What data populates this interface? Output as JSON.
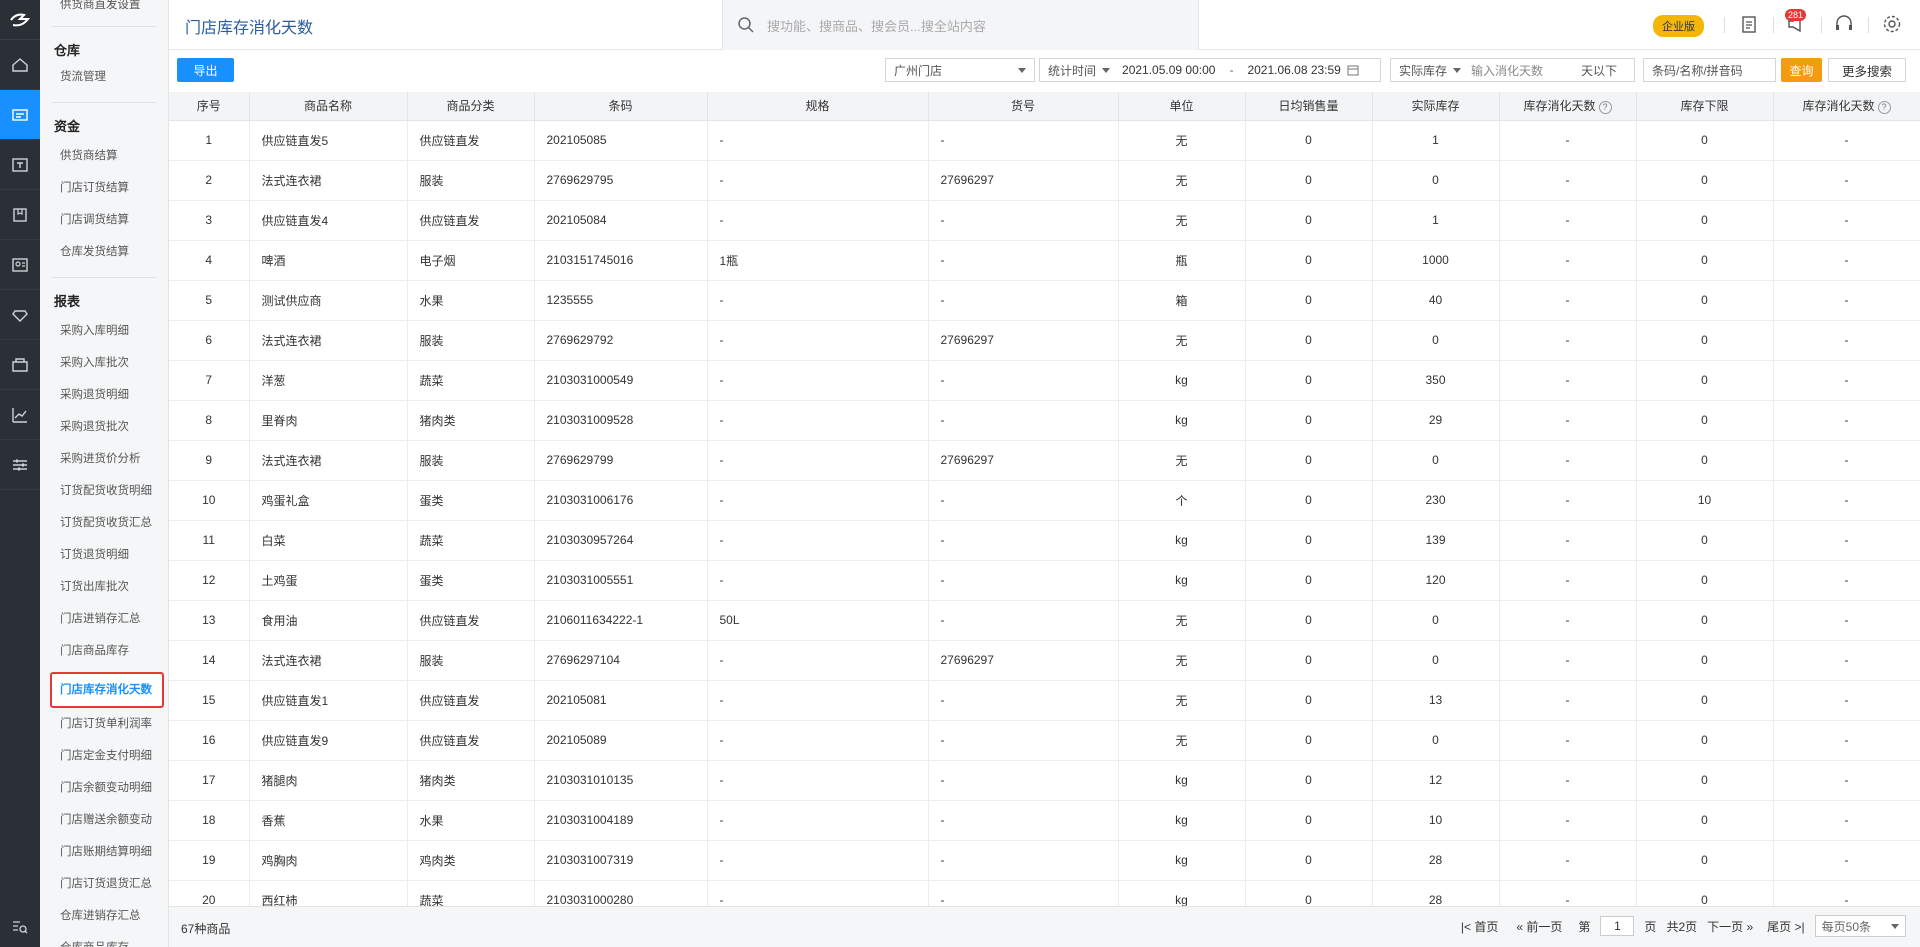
{
  "header": {
    "title": "门店库存消化天数",
    "search_placeholder": "搜功能、搜商品、搜会员...搜全站内容",
    "edition": "企业版",
    "notify_count": "281"
  },
  "menu": {
    "top_item": "供货商直发设置",
    "sections": [
      {
        "title": "仓库",
        "items": [
          "货流管理"
        ]
      },
      {
        "title": "资金",
        "items": [
          "供货商结算",
          "门店订货结算",
          "门店调货结算",
          "仓库发货结算"
        ]
      },
      {
        "title": "报表",
        "items": [
          "采购入库明细",
          "采购入库批次",
          "采购退货明细",
          "采购退货批次",
          "采购进货价分析",
          "订货配货收货明细",
          "订货配货收货汇总",
          "订货退货明细",
          "订货出库批次",
          "门店进销存汇总",
          "门店商品库存",
          "门店库存消化天数",
          "门店订货单利润率",
          "门店定金支付明细",
          "门店余额变动明细",
          "门店赠送余额变动",
          "门店账期结算明细",
          "门店订货退货汇总",
          "仓库进销存汇总",
          "仓库商品库存"
        ]
      }
    ],
    "active": "门店库存消化天数"
  },
  "toolbar": {
    "export": "导出",
    "store": "广州门店",
    "stat_time": "统计时间",
    "date_from": "2021.05.09 00:00",
    "date_sep": "-",
    "date_to": "2021.06.08 23:59",
    "stock_type": "实际库存",
    "days_placeholder": "输入消化天数",
    "days_suffix": "天以下",
    "code_placeholder": "条码/名称/拼音码",
    "query": "查询",
    "more": "更多搜索"
  },
  "table": {
    "headers": [
      "序号",
      "商品名称",
      "商品分类",
      "条码",
      "规格",
      "货号",
      "单位",
      "日均销售量",
      "实际库存",
      "库存消化天数",
      "库存下限",
      "库存消化天数"
    ],
    "rows": [
      [
        "1",
        "供应链直发5",
        "供应链直发",
        "202105085",
        "-",
        "-",
        "无",
        "0",
        "1",
        "-",
        "0",
        "-"
      ],
      [
        "2",
        "法式连衣裙",
        "服装",
        "2769629795",
        "-",
        "27696297",
        "无",
        "0",
        "0",
        "-",
        "0",
        "-"
      ],
      [
        "3",
        "供应链直发4",
        "供应链直发",
        "202105084",
        "-",
        "-",
        "无",
        "0",
        "1",
        "-",
        "0",
        "-"
      ],
      [
        "4",
        "啤酒",
        "电子烟",
        "2103151745016",
        "1瓶",
        "-",
        "瓶",
        "0",
        "1000",
        "-",
        "0",
        "-"
      ],
      [
        "5",
        "测试供应商",
        "水果",
        "1235555",
        "-",
        "-",
        "箱",
        "0",
        "40",
        "-",
        "0",
        "-"
      ],
      [
        "6",
        "法式连衣裙",
        "服装",
        "2769629792",
        "-",
        "27696297",
        "无",
        "0",
        "0",
        "-",
        "0",
        "-"
      ],
      [
        "7",
        "洋葱",
        "蔬菜",
        "2103031000549",
        "-",
        "-",
        "kg",
        "0",
        "350",
        "-",
        "0",
        "-"
      ],
      [
        "8",
        "里脊肉",
        "猪肉类",
        "2103031009528",
        "-",
        "-",
        "kg",
        "0",
        "29",
        "-",
        "0",
        "-"
      ],
      [
        "9",
        "法式连衣裙",
        "服装",
        "2769629799",
        "-",
        "27696297",
        "无",
        "0",
        "0",
        "-",
        "0",
        "-"
      ],
      [
        "10",
        "鸡蛋礼盒",
        "蛋类",
        "2103031006176",
        "-",
        "-",
        "个",
        "0",
        "230",
        "-",
        "10",
        "-"
      ],
      [
        "11",
        "白菜",
        "蔬菜",
        "2103030957264",
        "-",
        "-",
        "kg",
        "0",
        "139",
        "-",
        "0",
        "-"
      ],
      [
        "12",
        "土鸡蛋",
        "蛋类",
        "2103031005551",
        "-",
        "-",
        "kg",
        "0",
        "120",
        "-",
        "0",
        "-"
      ],
      [
        "13",
        "食用油",
        "供应链直发",
        "2106011634222-1",
        "50L",
        "-",
        "无",
        "0",
        "0",
        "-",
        "0",
        "-"
      ],
      [
        "14",
        "法式连衣裙",
        "服装",
        "27696297104",
        "-",
        "27696297",
        "无",
        "0",
        "0",
        "-",
        "0",
        "-"
      ],
      [
        "15",
        "供应链直发1",
        "供应链直发",
        "202105081",
        "-",
        "-",
        "无",
        "0",
        "13",
        "-",
        "0",
        "-"
      ],
      [
        "16",
        "供应链直发9",
        "供应链直发",
        "202105089",
        "-",
        "-",
        "无",
        "0",
        "0",
        "-",
        "0",
        "-"
      ],
      [
        "17",
        "猪腿肉",
        "猪肉类",
        "2103031010135",
        "-",
        "-",
        "kg",
        "0",
        "12",
        "-",
        "0",
        "-"
      ],
      [
        "18",
        "香蕉",
        "水果",
        "2103031004189",
        "-",
        "-",
        "kg",
        "0",
        "10",
        "-",
        "0",
        "-"
      ],
      [
        "19",
        "鸡胸肉",
        "鸡肉类",
        "2103031007319",
        "-",
        "-",
        "kg",
        "0",
        "28",
        "-",
        "0",
        "-"
      ],
      [
        "20",
        "西红柿",
        "蔬菜",
        "2103031000280",
        "-",
        "-",
        "kg",
        "0",
        "28",
        "-",
        "0",
        "-"
      ]
    ]
  },
  "footer": {
    "count": "67种商品",
    "first": "首页",
    "prev": "前一页",
    "page_label": "第",
    "page_value": "1",
    "page_unit": "页",
    "total": "共2页",
    "next": "下一页",
    "last": "尾页",
    "per_page": "每页50条"
  },
  "colors": {
    "accent": "#1890ff",
    "query": "#f39c12",
    "edition": "#f5b60a",
    "highlight_border": "#e53935"
  }
}
